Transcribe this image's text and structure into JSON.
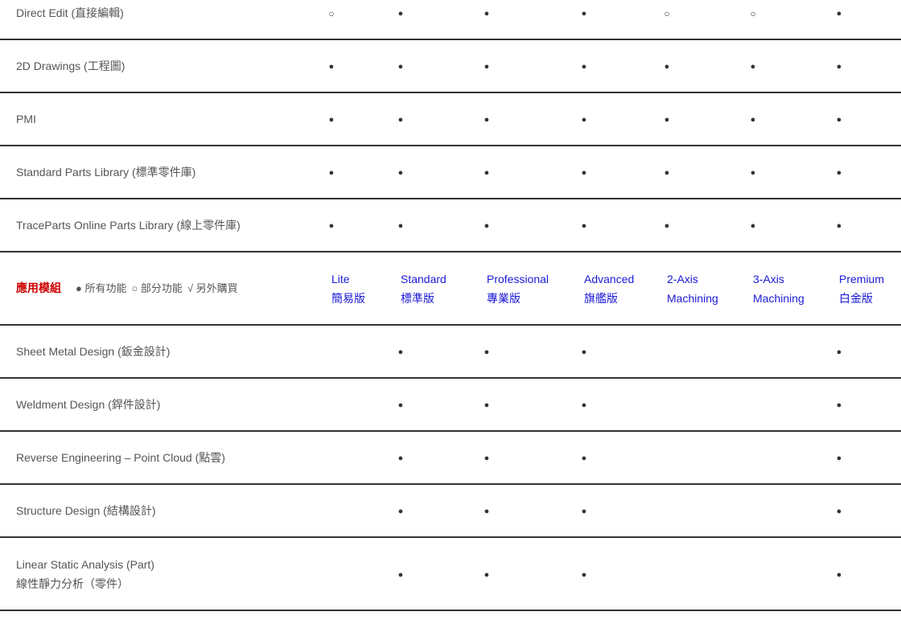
{
  "legend": {
    "title": "應用模組",
    "full": "● 所有功能",
    "partial": "○ 部分功能",
    "purchase": "√ 另外購買"
  },
  "editions": [
    {
      "en": "Lite",
      "zh": "簡易版"
    },
    {
      "en": "Standard",
      "zh": "標準版"
    },
    {
      "en": "Professional",
      "zh": "專業版"
    },
    {
      "en": "Advanced",
      "zh": "旗艦版"
    },
    {
      "en": "2-Axis",
      "zh": "Machining"
    },
    {
      "en": "3-Axis",
      "zh": "Machining"
    },
    {
      "en": "Premium",
      "zh": "白金版"
    }
  ],
  "symbols": {
    "full": "●",
    "partial": "○"
  },
  "top_rows": [
    {
      "name": "Direct Edit (直接編輯)",
      "marks": [
        "○",
        "●",
        "●",
        "●",
        "○",
        "○",
        "●"
      ]
    },
    {
      "name": "2D Drawings (工程圖)",
      "marks": [
        "●",
        "●",
        "●",
        "●",
        "●",
        "●",
        "●"
      ]
    },
    {
      "name": "PMI",
      "marks": [
        "●",
        "●",
        "●",
        "●",
        "●",
        "●",
        "●"
      ]
    },
    {
      "name": "Standard Parts Library (標準零件庫)",
      "marks": [
        "●",
        "●",
        "●",
        "●",
        "●",
        "●",
        "●"
      ]
    },
    {
      "name": "TraceParts Online Parts Library (線上零件庫)",
      "marks": [
        "●",
        "●",
        "●",
        "●",
        "●",
        "●",
        "●"
      ]
    }
  ],
  "module_rows": [
    {
      "name": "Sheet Metal Design (鈑金設計)",
      "name2": "",
      "marks": [
        "",
        "●",
        "●",
        "●",
        "",
        "",
        "●"
      ]
    },
    {
      "name": "Weldment Design (銲件設計)",
      "name2": "",
      "marks": [
        "",
        "●",
        "●",
        "●",
        "",
        "",
        "●"
      ]
    },
    {
      "name": "Reverse Engineering – Point Cloud (點雲)",
      "name2": "",
      "marks": [
        "",
        "●",
        "●",
        "●",
        "",
        "",
        "●"
      ]
    },
    {
      "name": "Structure Design (結構設計)",
      "name2": "",
      "marks": [
        "",
        "●",
        "●",
        "●",
        "",
        "",
        "●"
      ]
    },
    {
      "name": "Linear Static Analysis (Part)",
      "name2": "線性靜力分析（零件）",
      "marks": [
        "",
        "●",
        "●",
        "●",
        "",
        "",
        "●"
      ]
    }
  ]
}
